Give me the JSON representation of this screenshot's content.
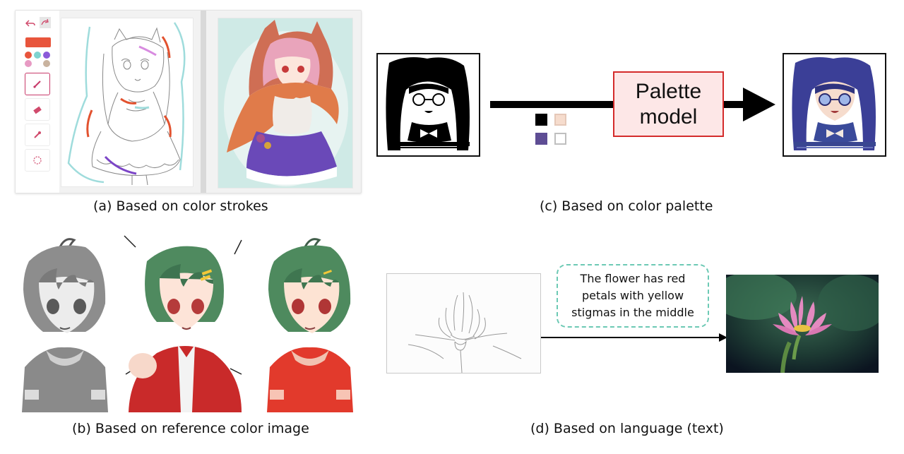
{
  "captions": {
    "a": "(a) Based on color strokes",
    "b": "(b) Based on reference color image",
    "c": "(c) Based on color palette",
    "d": "(d) Based on language (text)"
  },
  "palette_model": {
    "line1": "Palette",
    "line2": "model"
  },
  "text_prompt": {
    "line1": "The flower has red",
    "line2": "petals with yellow",
    "line3": "stigmas in the middle"
  },
  "app": {
    "tools": [
      "undo-icon",
      "redo-icon",
      "brush-icon",
      "eraser-icon",
      "eyedropper-icon",
      "lasso-icon"
    ],
    "swatches": [
      "#e8553c",
      "#e8553c",
      "#7fd3cf",
      "#8b5bd9",
      "#e79ac3",
      "#c9b39f"
    ]
  },
  "palette_colors": [
    "#000000",
    "#f6dccd",
    "#5e4d94",
    "#ffffff"
  ],
  "colors": {
    "accent_red": "#d42b2b",
    "palette_fill": "#fde7e7",
    "bubble_border": "#6cc9b4",
    "app_active": "#c83a6a"
  }
}
